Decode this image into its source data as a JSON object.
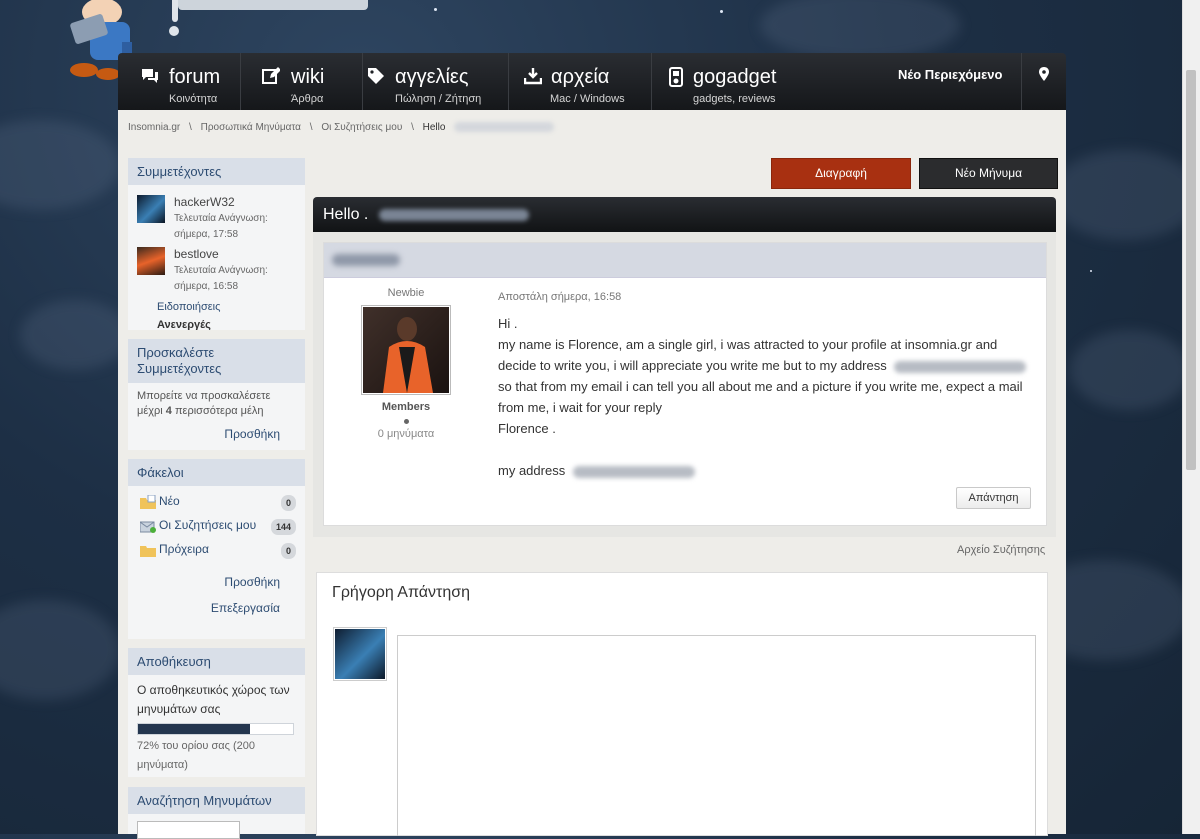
{
  "nav": {
    "items": [
      {
        "title": "forum",
        "sub": "Κοινότητα",
        "icon": "chat-icon"
      },
      {
        "title": "wiki",
        "sub": "Άρθρα",
        "icon": "edit-icon"
      },
      {
        "title": "αγγελίες",
        "sub": "Πώληση / Ζήτηση",
        "icon": "tag-icon"
      },
      {
        "title": "αρχεία",
        "sub": "Mac / Windows",
        "icon": "download-icon"
      },
      {
        "title": "gogadget",
        "sub": "gadgets, reviews",
        "icon": "ipod-icon"
      }
    ],
    "new_content": "Νέο Περιεχόμενο",
    "pin_icon": "map-pin-icon"
  },
  "breadcrumb": {
    "items": [
      "Insomnia.gr",
      "Προσωπικά Μηνύματα",
      "Οι Συζητήσεις μου",
      "Hello"
    ],
    "separator": "\\"
  },
  "sidebar": {
    "participants": {
      "heading": "Συμμετέχοντες",
      "list": [
        {
          "name": "hackerW32",
          "last_read_label": "Τελευταία Ανάγνωση:",
          "last_read": "σήμερα, 17:58"
        },
        {
          "name": "bestlove",
          "last_read_label": "Τελευταία Ανάγνωση:",
          "last_read": "σήμερα, 16:58"
        }
      ],
      "notifications": "Ειδοποιήσεις",
      "active": "Ανενεργές"
    },
    "invite": {
      "heading": "Προσκαλέστε Συμμετέχοντες",
      "text_prefix": "Μπορείτε να προσκαλέσετε μέχρι",
      "count": "4",
      "text_suffix": "περισσότερα μέλη",
      "add": "Προσθήκη"
    },
    "folders": {
      "heading": "Φάκελοι",
      "list": [
        {
          "name": "Νέο",
          "count": "0",
          "icon": "new-folder-icon"
        },
        {
          "name": "Οι Συζητήσεις μου",
          "count": "144",
          "icon": "inbox-folder-icon"
        },
        {
          "name": "Πρόχειρα",
          "count": "0",
          "icon": "drafts-folder-icon"
        }
      ],
      "add": "Προσθήκη",
      "edit": "Επεξεργασία"
    },
    "storage": {
      "heading": "Αποθήκευση",
      "text": "Ο αποθηκευτικός χώρος των μηνυμάτων σας",
      "percent": 72,
      "usage": "72% του ορίου σας (200 μηνύματα)"
    },
    "search": {
      "heading": "Αναζήτηση Μηνυμάτων"
    }
  },
  "actions": {
    "delete": "Διαγραφή",
    "new_message": "Νέο Μήνυμα"
  },
  "conversation": {
    "title": "Hello .",
    "sender": {
      "title": "Newbie",
      "group": "Members",
      "posts": "0 μηνύματα"
    },
    "sent": "Αποστάλη σήμερα, 16:58",
    "lines": [
      "Hi .",
      "my name is Florence, am a single girl, i was attracted to your profile at insomnia.gr and",
      "decide to write you, i will appreciate you write me but to my address",
      "so that from my email i can tell you all about me and a picture if you write me, expect a mail",
      "from me, i wait for your reply",
      "Florence .",
      "",
      "my address"
    ],
    "reply": "Απάντηση",
    "archive": "Αρχείο Συζήτησης"
  },
  "quick_reply": {
    "title": "Γρήγορη Απάντηση"
  },
  "colors": {
    "accent": "#2d4c72",
    "delete": "#a83011",
    "dark": "#2b2c2e"
  }
}
